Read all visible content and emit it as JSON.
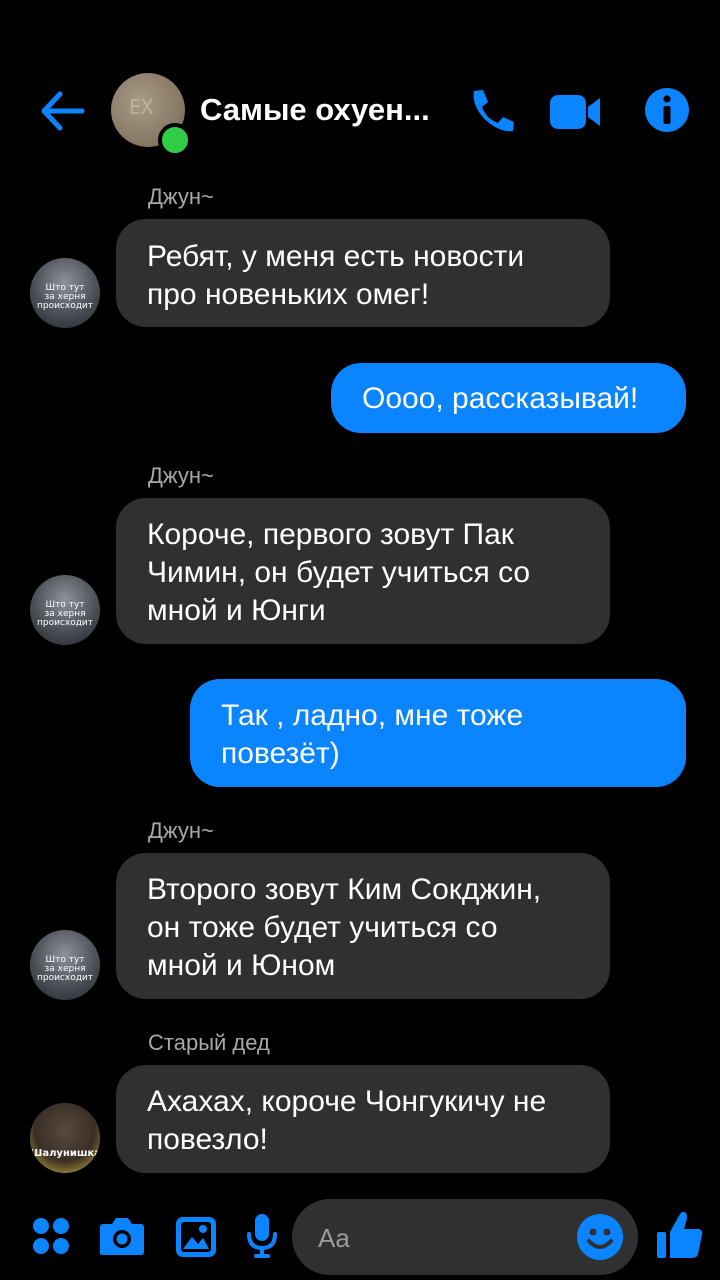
{
  "header": {
    "title": "Самые охуен...",
    "avatar_text": "ЕХ",
    "icons": [
      "back-arrow-icon",
      "phone-icon",
      "video-camera-icon",
      "info-icon"
    ],
    "accent": "#0a84ff",
    "online_color": "#31cc46"
  },
  "messages": [
    {
      "sender": "Джун~",
      "lines": [
        "Ребят, у меня есть новости",
        "про новеньких омег!"
      ],
      "direction": "incoming"
    },
    {
      "lines": [
        "Оооо, рассказывай!"
      ],
      "direction": "outgoing"
    },
    {
      "sender": "Джун~",
      "lines": [
        "Короче, первого зовут Пак",
        "Чимин, он будет учиться со",
        "мной и Юнги"
      ],
      "direction": "incoming"
    },
    {
      "lines": [
        "Так , ладно, мне тоже",
        "повезёт)"
      ],
      "direction": "outgoing"
    },
    {
      "sender": "Джун~",
      "lines": [
        "Второго зовут Ким Сокджин,",
        "он тоже будет учиться со",
        "мной и Юном"
      ],
      "direction": "incoming"
    },
    {
      "sender": "Старый дед",
      "lines": [
        "Ахахах, короче Чонгукичу не",
        "повезло!"
      ],
      "direction": "incoming"
    }
  ],
  "avatars": {
    "jun_caption": [
      "Што тут",
      "за херня",
      "происходит"
    ],
    "ded_caption": "Шалунишка"
  },
  "composer": {
    "placeholder": "Aa",
    "icons": [
      "menu-grid-icon",
      "camera-icon",
      "gallery-icon",
      "microphone-icon",
      "emoji-icon",
      "thumbs-up-icon"
    ]
  }
}
